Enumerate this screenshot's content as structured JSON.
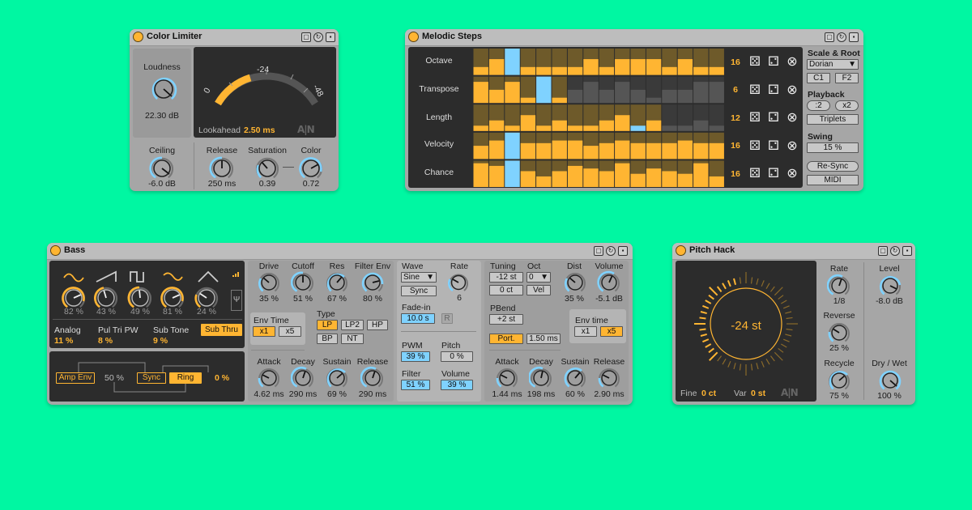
{
  "colors": {
    "background": "#00F7A2",
    "accent": "#FFB532",
    "blue": "#7FD2FF",
    "panel": "#a6a6a6",
    "dark": "#2c2c2c"
  },
  "title_icons": [
    "crop-icon",
    "refresh-icon",
    "save-icon"
  ],
  "color_limiter": {
    "title": "Color Limiter",
    "loudness_label": "Loudness",
    "loudness_value": "22.30 dB",
    "meter_ticks": {
      "left": "0",
      "mid": "-24",
      "right": "-48"
    },
    "lookahead_label": "Lookahead",
    "lookahead_value": "2.50 ms",
    "logo": "A|N",
    "ceiling_label": "Ceiling",
    "ceiling_value": "-6.0 dB",
    "release_label": "Release",
    "release_value": "250 ms",
    "saturation_label": "Saturation",
    "saturation_value": "0.39",
    "color_label": "Color",
    "color_value": "0.72"
  },
  "melodic_steps": {
    "title": "Melodic Steps",
    "lanes": [
      {
        "label": "Octave",
        "length": "16"
      },
      {
        "label": "Transpose",
        "length": "6"
      },
      {
        "label": "Length",
        "length": "12"
      },
      {
        "label": "Velocity",
        "length": "16"
      },
      {
        "label": "Chance",
        "length": "16"
      }
    ],
    "scale_root_label": "Scale & Root",
    "scale": "Dorian",
    "root_low": "C1",
    "root_high": "F2",
    "playback_label": "Playback",
    "playback_half": ":2",
    "playback_double": "x2",
    "triplets": "Triplets",
    "swing_label": "Swing",
    "swing_value": "15 %",
    "resync": "Re-Sync",
    "midi": "MIDI"
  },
  "bass": {
    "title": "Bass",
    "osc_values": [
      "82 %",
      "43 %",
      "49 %",
      "81 %",
      "24 %"
    ],
    "analog_label": "Analog",
    "analog_value": "11 %",
    "pultri_label": "Pul Tri PW",
    "pultri_value": "8 %",
    "subtone_label": "Sub Tone",
    "subtone_value": "9 %",
    "subthru": "Sub Thru",
    "amp_env": "Amp Env",
    "mod_value": "50 %",
    "sync": "Sync",
    "ring": "Ring",
    "ring_value": "0 %",
    "drive_label": "Drive",
    "drive_value": "35 %",
    "cutoff_label": "Cutoff",
    "cutoff_value": "51 %",
    "res_label": "Res",
    "res_value": "67 %",
    "filterenv_label": "Filter Env",
    "filterenv_value": "80 %",
    "envtime_label": "Env Time",
    "x1": "x1",
    "x5": "x5",
    "type_label": "Type",
    "types": [
      "LP",
      "LP2",
      "HP",
      "BP",
      "NT"
    ],
    "attack_label": "Attack",
    "attack_value": "4.62 ms",
    "decay_label": "Decay",
    "decay_value": "290 ms",
    "sustain_label": "Sustain",
    "sustain_value": "69 %",
    "release_label": "Release",
    "release_value": "290 ms",
    "wave_label": "Wave",
    "wave_value": "Sine",
    "rate_label": "Rate",
    "rate_value": "6",
    "sync_btn": "Sync",
    "fadein_label": "Fade-in",
    "fadein_value": "10.0 s",
    "r_btn": "R",
    "pwm_label": "PWM",
    "pwm_value": "39 %",
    "pitch_label": "Pitch",
    "pitch_value": "0 %",
    "filter_label": "Filter",
    "filter_value": "51 %",
    "volume_label": "Volume",
    "volume_value": "39 %",
    "tuning_label": "Tuning",
    "tuning_value": "-12 st",
    "tuning_fine": "0 ct",
    "oct_label": "Oct",
    "oct_value": "0",
    "vel_btn": "Vel",
    "dist_label": "Dist",
    "dist_value": "35 %",
    "vol2_label": "Volume",
    "vol2_value": "-5.1 dB",
    "pbend_label": "PBend",
    "pbend_value": "+2 st",
    "port_btn": "Port.",
    "port_value": "1.50 ms",
    "envtime2_label": "Env time",
    "x1b": "x1",
    "x5b": "x5",
    "attack2_label": "Attack",
    "attack2_value": "1.44 ms",
    "decay2_label": "Decay",
    "decay2_value": "198 ms",
    "sustain2_label": "Sustain",
    "sustain2_value": "60 %",
    "release2_label": "Release",
    "release2_value": "2.90 ms"
  },
  "pitch_hack": {
    "title": "Pitch Hack",
    "center_value": "-24 st",
    "fine_label": "Fine",
    "fine_value": "0 ct",
    "var_label": "Var",
    "var_value": "0 st",
    "logo": "A|N",
    "rate_label": "Rate",
    "rate_value": "1/8",
    "reverse_label": "Reverse",
    "reverse_value": "25 %",
    "recycle_label": "Recycle",
    "recycle_value": "75 %",
    "level_label": "Level",
    "level_value": "-8.0 dB",
    "drywet_label": "Dry / Wet",
    "drywet_value": "100 %"
  }
}
